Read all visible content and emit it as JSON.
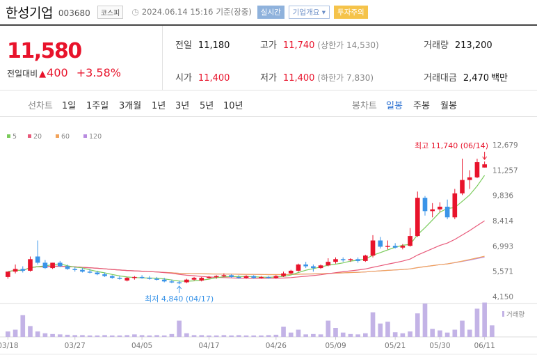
{
  "header": {
    "company_name": "한성기업",
    "code": "003680",
    "market": "코스피",
    "timestamp": "2024.06.14 15:16",
    "timestamp_suffix": "기준(장중)",
    "badge_live": "실시간",
    "badge_info": "기업개요",
    "badge_warn": "투자주의"
  },
  "price": {
    "current": "11,580",
    "change_label": "전일대비",
    "change_value": "400",
    "change_pct": "+3.58%"
  },
  "stats": {
    "prev_close_label": "전일",
    "prev_close": "11,180",
    "open_label": "시가",
    "open": "11,400",
    "high_label": "고가",
    "high": "11,740",
    "upper_limit": "(상한가 14,530)",
    "low_label": "저가",
    "low": "11,400",
    "lower_limit": "(하한가 7,830)",
    "volume_label": "거래량",
    "volume": "213,200",
    "amount_label": "거래대금",
    "amount": "2,470",
    "amount_unit": "백만"
  },
  "tabs": {
    "periods": [
      "선차트",
      "1일",
      "1주일",
      "3개월",
      "1년",
      "3년",
      "5년",
      "10년"
    ],
    "candle_types": [
      "봉차트",
      "일봉",
      "주봉",
      "월봉"
    ],
    "active_candle": "일봉"
  },
  "colors": {
    "up": "#e8132b",
    "down": "#3a94e8",
    "ma5": "#7acb5b",
    "ma20": "#e85a7a",
    "ma60": "#f2a35a",
    "ma120": "#b88be0",
    "volume": "#c3b3e6"
  },
  "chart_data": {
    "type": "candlestick",
    "legend": [
      {
        "name": "5",
        "color": "#7acb5b"
      },
      {
        "name": "20",
        "color": "#e85a7a"
      },
      {
        "name": "60",
        "color": "#f2a35a"
      },
      {
        "name": "120",
        "color": "#b88be0"
      }
    ],
    "y_ticks": [
      "12,679",
      "11,257",
      "9,836",
      "8,414",
      "6,993",
      "5,571",
      "4,150"
    ],
    "ylim": [
      4150,
      12679
    ],
    "x_ticks": [
      "03/18",
      "03/27",
      "04/05",
      "04/17",
      "04/26",
      "05/09",
      "05/21",
      "05/30",
      "06/11"
    ],
    "volume_label": "거래량",
    "annotations": {
      "high": "최고 11,740 (06/14)",
      "low": "최저 4,840 (04/17)"
    },
    "candles": [
      [
        5250,
        5550,
        5150,
        5550
      ],
      [
        5550,
        5950,
        5450,
        5700
      ],
      [
        5700,
        5850,
        5500,
        5600
      ],
      [
        5600,
        6400,
        5550,
        6250
      ],
      [
        6400,
        7300,
        5950,
        6050
      ],
      [
        6050,
        6200,
        5700,
        5750
      ],
      [
        5750,
        6050,
        5700,
        6050
      ],
      [
        6050,
        6150,
        5800,
        5850
      ],
      [
        5850,
        5950,
        5650,
        5700
      ],
      [
        5700,
        5800,
        5550,
        5650
      ],
      [
        5650,
        5750,
        5500,
        5550
      ],
      [
        5550,
        5700,
        5450,
        5500
      ],
      [
        5500,
        5600,
        5350,
        5400
      ],
      [
        5400,
        5500,
        5250,
        5300
      ],
      [
        5300,
        5350,
        5150,
        5200
      ],
      [
        5200,
        5300,
        5100,
        5150
      ],
      [
        5050,
        5250,
        5000,
        5200
      ],
      [
        5200,
        5300,
        5100,
        5250
      ],
      [
        5250,
        5350,
        5150,
        5200
      ],
      [
        5200,
        5300,
        5100,
        5150
      ],
      [
        5150,
        5250,
        5050,
        5100
      ],
      [
        5100,
        5200,
        4950,
        5000
      ],
      [
        5000,
        5100,
        4900,
        4950
      ],
      [
        4950,
        5050,
        4840,
        4900
      ],
      [
        4950,
        5150,
        4900,
        5100
      ],
      [
        5100,
        5250,
        5050,
        5200
      ],
      [
        5050,
        5250,
        5000,
        5200
      ],
      [
        5200,
        5300,
        5150,
        5250
      ],
      [
        5250,
        5350,
        5150,
        5300
      ],
      [
        5300,
        5450,
        5250,
        5350
      ],
      [
        5350,
        5400,
        5200,
        5250
      ],
      [
        5250,
        5350,
        5150,
        5200
      ],
      [
        5200,
        5350,
        5150,
        5300
      ],
      [
        5300,
        5350,
        5150,
        5200
      ],
      [
        5200,
        5300,
        5150,
        5250
      ],
      [
        5250,
        5300,
        5150,
        5200
      ],
      [
        5200,
        5350,
        5150,
        5300
      ],
      [
        5300,
        5550,
        5250,
        5450
      ],
      [
        5450,
        5650,
        5400,
        5600
      ],
      [
        5600,
        6000,
        5550,
        5950
      ],
      [
        5950,
        6100,
        5750,
        5850
      ],
      [
        5850,
        5950,
        5550,
        5750
      ],
      [
        5750,
        5950,
        5700,
        5900
      ],
      [
        5900,
        6300,
        5850,
        6100
      ],
      [
        6100,
        6350,
        6000,
        6250
      ],
      [
        6250,
        6350,
        6100,
        6200
      ],
      [
        6200,
        6300,
        6100,
        6250
      ],
      [
        6250,
        6350,
        6050,
        6150
      ],
      [
        6150,
        6500,
        6100,
        6450
      ],
      [
        6450,
        7600,
        6350,
        7300
      ],
      [
        7300,
        7500,
        6850,
        6950
      ],
      [
        6950,
        7300,
        6800,
        7000
      ],
      [
        7000,
        7150,
        6850,
        6900
      ],
      [
        6900,
        7100,
        6800,
        7000
      ],
      [
        7000,
        8000,
        6950,
        7550
      ],
      [
        7550,
        10050,
        7500,
        9700
      ],
      [
        9700,
        9800,
        8700,
        8950
      ],
      [
        8950,
        9400,
        8600,
        9050
      ],
      [
        9050,
        9450,
        8900,
        9200
      ],
      [
        9200,
        9600,
        8500,
        8600
      ],
      [
        8600,
        10200,
        8500,
        9950
      ],
      [
        9950,
        11900,
        9850,
        10700
      ],
      [
        10700,
        11250,
        10200,
        10850
      ],
      [
        10850,
        11900,
        10800,
        11700
      ],
      [
        11400,
        11740,
        11400,
        11580
      ]
    ],
    "volumes": [
      0.15,
      0.2,
      0.6,
      0.3,
      0.15,
      0.1,
      0.08,
      0.07,
      0.06,
      0.05,
      0.05,
      0.04,
      0.04,
      0.05,
      0.04,
      0.04,
      0.05,
      0.07,
      0.05,
      0.04,
      0.05,
      0.04,
      0.08,
      0.45,
      0.1,
      0.05,
      0.05,
      0.04,
      0.04,
      0.05,
      0.04,
      0.05,
      0.04,
      0.04,
      0.04,
      0.05,
      0.06,
      0.28,
      0.12,
      0.2,
      0.07,
      0.08,
      0.07,
      0.45,
      0.25,
      0.12,
      0.08,
      0.07,
      0.1,
      0.68,
      0.37,
      0.42,
      0.13,
      0.1,
      0.15,
      0.65,
      0.92,
      0.22,
      0.18,
      0.12,
      0.2,
      0.45,
      0.2,
      0.78,
      0.95,
      0.32
    ]
  }
}
